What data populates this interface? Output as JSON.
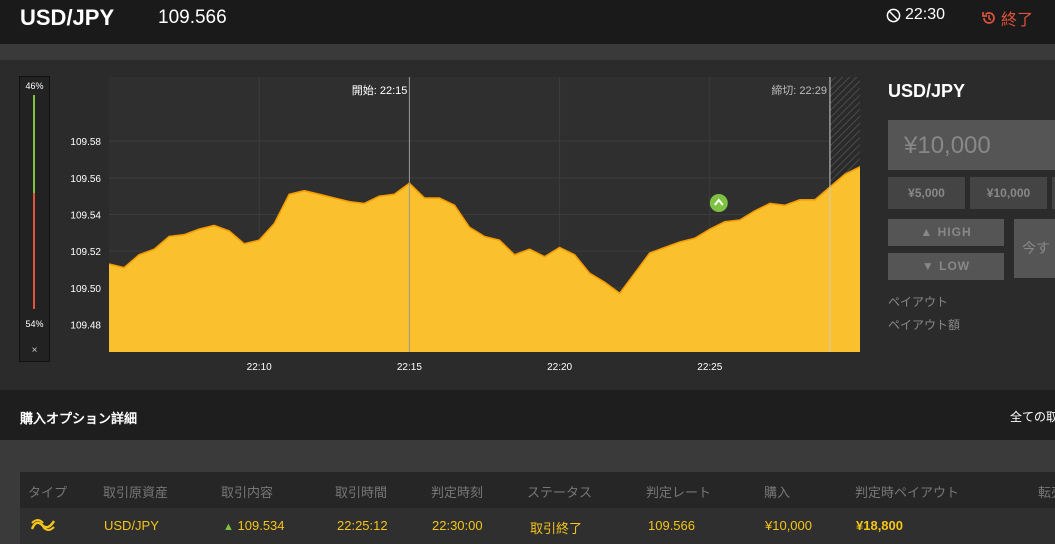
{
  "header": {
    "pair": "USD/JPY",
    "price": "109.566",
    "timer": "22:30",
    "ended_label": "終了"
  },
  "gauge": {
    "top_pct": "46%",
    "bottom_pct": "54%",
    "high_fraction": 0.46,
    "close_label": "×"
  },
  "colors": {
    "area_fill": "#fbc02d",
    "area_line": "#f59b00",
    "high": "#7ec242",
    "low": "#e0533c",
    "highlight": "#f5c518"
  },
  "chart_data": {
    "type": "area",
    "xtick_labels": [
      "22:10",
      "22:15",
      "22:20",
      "22:25"
    ],
    "ytick_labels": [
      "109.58",
      "109.56",
      "109.54",
      "109.52",
      "109.50",
      "109.48"
    ],
    "ylim": [
      109.465,
      109.615
    ],
    "xlim": [
      0,
      25
    ],
    "annotations": {
      "start": "開始: 22:15",
      "deadline": "締切: 22:29"
    },
    "x": [
      0,
      0.5,
      1,
      1.5,
      2,
      2.5,
      3,
      3.5,
      4,
      4.5,
      5,
      5.5,
      6,
      6.5,
      7,
      7.5,
      8,
      8.5,
      9,
      9.5,
      10,
      10.5,
      11,
      11.5,
      12,
      12.5,
      13,
      13.5,
      14,
      14.5,
      15,
      15.5,
      16,
      16.5,
      17,
      17.5,
      18,
      18.5,
      19,
      19.5,
      20,
      20.5,
      21,
      21.5,
      22,
      22.5,
      23,
      23.5,
      24,
      24.5,
      25
    ],
    "y": [
      109.513,
      109.511,
      109.518,
      109.521,
      109.528,
      109.529,
      109.532,
      109.534,
      109.531,
      109.524,
      109.526,
      109.535,
      109.551,
      109.553,
      109.551,
      109.549,
      109.547,
      109.546,
      109.55,
      109.551,
      109.557,
      109.549,
      109.549,
      109.545,
      109.533,
      109.528,
      109.526,
      109.518,
      109.521,
      109.517,
      109.522,
      109.518,
      109.508,
      109.503,
      109.497,
      109.508,
      109.519,
      109.522,
      109.525,
      109.527,
      109.532,
      109.536,
      109.537,
      109.542,
      109.546,
      109.545,
      109.548,
      109.548,
      109.555,
      109.562,
      109.566
    ],
    "entry_marker": {
      "x": 20.3,
      "y": 109.543
    }
  },
  "side": {
    "title": "USD/JPY",
    "amount": "¥10,000",
    "chips": [
      "¥5,000",
      "¥10,000"
    ],
    "high_label": "HIGH",
    "low_label": "LOW",
    "big_button": "今す",
    "payout_label": "ペイアウト",
    "payout_amount_label": "ペイアウト額"
  },
  "section": {
    "title": "購入オプション詳細",
    "right": "全ての取"
  },
  "table": {
    "headers": [
      "タイプ",
      "取引原資産",
      "取引内容",
      "取引時間",
      "判定時刻",
      "ステータス",
      "判定レート",
      "購入",
      "判定時ペイアウト",
      "転売"
    ],
    "row": {
      "asset": "USD/JPY",
      "content": "109.534",
      "time": "22:25:12",
      "judge_time": "22:30:00",
      "status": "取引終了",
      "rate": "109.566",
      "purchase": "¥10,000",
      "payout": "¥18,800"
    }
  }
}
